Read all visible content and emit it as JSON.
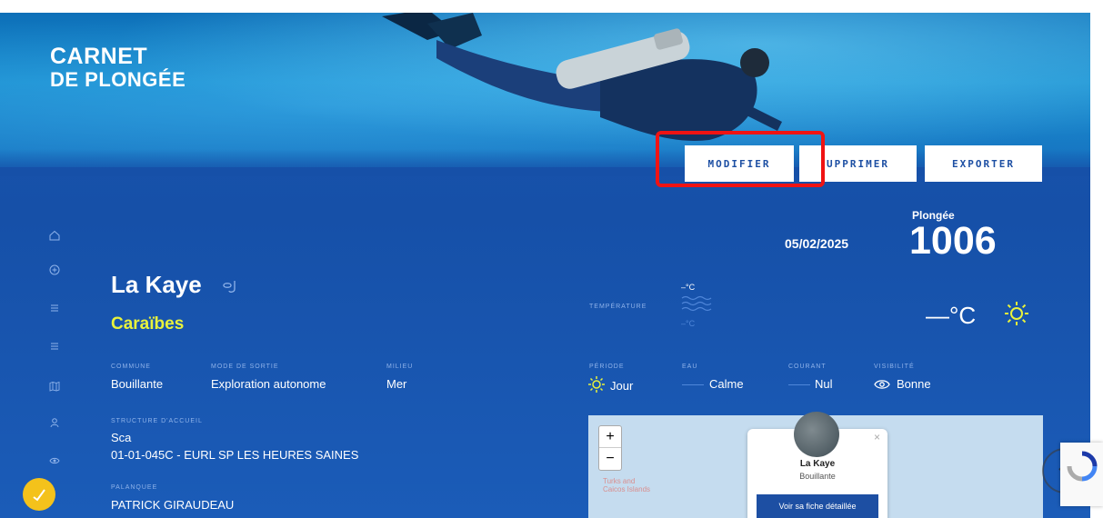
{
  "brand": {
    "line1": "CARNET",
    "line2": "DE PLONGÉE"
  },
  "actions": {
    "modify": "MODIFIER",
    "delete": "UPPRIMER",
    "export": "EXPORTER"
  },
  "dive": {
    "date": "05/02/2025",
    "number_label": "Plongée",
    "number": "1006",
    "site_name": "La Kaye",
    "region": "Caraïbes",
    "temperature_label": "TEMPÉRATURE",
    "temp_top": "–°C",
    "temp_bottom": "–°C",
    "temp_big": "—°C"
  },
  "details": {
    "commune_label": "COMMUNE",
    "commune": "Bouillante",
    "mode_label": "MODE DE SORTIE",
    "mode": "Exploration autonome",
    "milieu_label": "MILIEU",
    "milieu": "Mer",
    "structure_label": "STRUCTURE D'ACCUEIL",
    "structure_name": "Sca",
    "structure_detail": "01-01-045C - EURL SP LES HEURES SAINES",
    "palanquee_label": "PALANQUEE",
    "palanquee": "PATRICK GIRAUDEAU"
  },
  "conditions": {
    "period_label": "PÉRIODE",
    "period": "Jour",
    "water_label": "EAU",
    "water": "Calme",
    "current_label": "COURANT",
    "current": "Nul",
    "visibility_label": "VISIBILITÉ",
    "visibility": "Bonne"
  },
  "map": {
    "zoom_in": "+",
    "zoom_out": "−",
    "place_label": "Turks and\nCaicos Islands",
    "popup_title": "La Kaye",
    "popup_sub": "Bouillante",
    "popup_button": "Voir sa fiche détaillée",
    "popup_close": "×"
  },
  "colors": {
    "accent_yellow": "#e8f23c",
    "highlight_red": "#f01313",
    "button_text": "#1d4fa3"
  }
}
